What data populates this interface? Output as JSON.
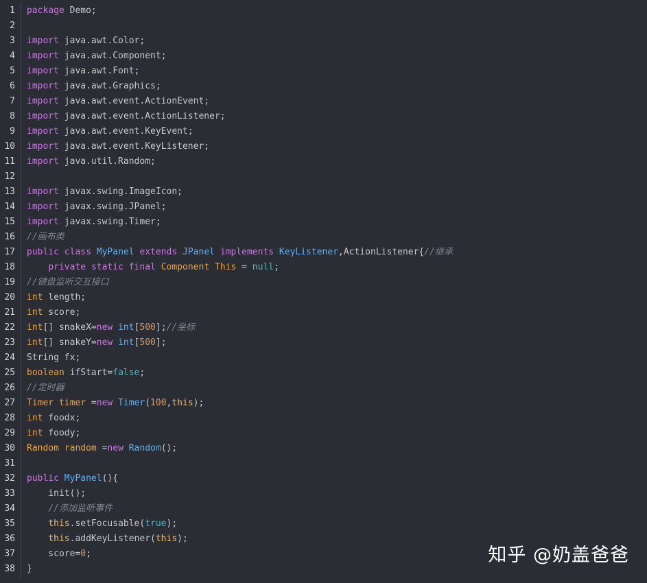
{
  "editor": {
    "lines": [
      {
        "n": "1",
        "t": [
          [
            "kw",
            "package"
          ],
          [
            "p",
            " Demo;"
          ]
        ]
      },
      {
        "n": "2",
        "t": []
      },
      {
        "n": "3",
        "t": [
          [
            "kw",
            "import"
          ],
          [
            "p",
            " java.awt.Color;"
          ]
        ]
      },
      {
        "n": "4",
        "t": [
          [
            "kw",
            "import"
          ],
          [
            "p",
            " java.awt.Component;"
          ]
        ]
      },
      {
        "n": "5",
        "t": [
          [
            "kw",
            "import"
          ],
          [
            "p",
            " java.awt.Font;"
          ]
        ]
      },
      {
        "n": "6",
        "t": [
          [
            "kw",
            "import"
          ],
          [
            "p",
            " java.awt.Graphics;"
          ]
        ]
      },
      {
        "n": "7",
        "t": [
          [
            "kw",
            "import"
          ],
          [
            "p",
            " java.awt.event.ActionEvent;"
          ]
        ]
      },
      {
        "n": "8",
        "t": [
          [
            "kw",
            "import"
          ],
          [
            "p",
            " java.awt.event.ActionListener;"
          ]
        ]
      },
      {
        "n": "9",
        "t": [
          [
            "kw",
            "import"
          ],
          [
            "p",
            " java.awt.event.KeyEvent;"
          ]
        ]
      },
      {
        "n": "10",
        "t": [
          [
            "kw",
            "import"
          ],
          [
            "p",
            " java.awt.event.KeyListener;"
          ]
        ]
      },
      {
        "n": "11",
        "t": [
          [
            "kw",
            "import"
          ],
          [
            "p",
            " java.util.Random;"
          ]
        ]
      },
      {
        "n": "12",
        "t": []
      },
      {
        "n": "13",
        "t": [
          [
            "kw",
            "import"
          ],
          [
            "p",
            " javax.swing.ImageIcon;"
          ]
        ]
      },
      {
        "n": "14",
        "t": [
          [
            "kw",
            "import"
          ],
          [
            "p",
            " javax.swing.JPanel;"
          ]
        ]
      },
      {
        "n": "15",
        "t": [
          [
            "kw",
            "import"
          ],
          [
            "p",
            " javax.swing.Timer;"
          ]
        ]
      },
      {
        "n": "16",
        "t": [
          [
            "cm",
            "//画布类"
          ]
        ]
      },
      {
        "n": "17",
        "t": [
          [
            "kw",
            "public"
          ],
          [
            "p",
            " "
          ],
          [
            "kw",
            "class"
          ],
          [
            "p",
            " "
          ],
          [
            "cl",
            "MyPanel"
          ],
          [
            "p",
            " "
          ],
          [
            "kw",
            "extends"
          ],
          [
            "p",
            " "
          ],
          [
            "cl",
            "JPanel"
          ],
          [
            "p",
            " "
          ],
          [
            "kw",
            "implements"
          ],
          [
            "p",
            " "
          ],
          [
            "cl",
            "KeyListener"
          ],
          [
            "p",
            ",ActionListener{"
          ],
          [
            "cm",
            "//继承"
          ]
        ]
      },
      {
        "n": "18",
        "t": [
          [
            "p",
            "    "
          ],
          [
            "kw",
            "private"
          ],
          [
            "p",
            " "
          ],
          [
            "kw",
            "static"
          ],
          [
            "p",
            " "
          ],
          [
            "kw",
            "final"
          ],
          [
            "p",
            " "
          ],
          [
            "ty",
            "Component"
          ],
          [
            "p",
            " "
          ],
          [
            "ty",
            "This"
          ],
          [
            "p",
            " = "
          ],
          [
            "ctrue",
            "null"
          ],
          [
            "p",
            ";"
          ]
        ]
      },
      {
        "n": "19",
        "t": [
          [
            "cm",
            "//键盘监听交互接口"
          ]
        ]
      },
      {
        "n": "20",
        "t": [
          [
            "ty",
            "int"
          ],
          [
            "p",
            " length;"
          ]
        ]
      },
      {
        "n": "21",
        "t": [
          [
            "ty",
            "int"
          ],
          [
            "p",
            " score;"
          ]
        ]
      },
      {
        "n": "22",
        "t": [
          [
            "ty",
            "int"
          ],
          [
            "p",
            "[] snakeX="
          ],
          [
            "kw",
            "new"
          ],
          [
            "p",
            " "
          ],
          [
            "cl",
            "int"
          ],
          [
            "p",
            "["
          ],
          [
            "num",
            "500"
          ],
          [
            "p",
            "];"
          ],
          [
            "cm",
            "//坐标"
          ]
        ]
      },
      {
        "n": "23",
        "t": [
          [
            "ty",
            "int"
          ],
          [
            "p",
            "[] snakeY="
          ],
          [
            "kw",
            "new"
          ],
          [
            "p",
            " "
          ],
          [
            "cl",
            "int"
          ],
          [
            "p",
            "["
          ],
          [
            "num",
            "500"
          ],
          [
            "p",
            "];"
          ]
        ]
      },
      {
        "n": "24",
        "t": [
          [
            "p",
            "String fx;"
          ]
        ]
      },
      {
        "n": "25",
        "t": [
          [
            "ty",
            "boolean"
          ],
          [
            "p",
            " ifStart="
          ],
          [
            "ctrue",
            "false"
          ],
          [
            "p",
            ";"
          ]
        ]
      },
      {
        "n": "26",
        "t": [
          [
            "cm",
            "//定时器"
          ]
        ]
      },
      {
        "n": "27",
        "t": [
          [
            "ty",
            "Timer"
          ],
          [
            "p",
            " "
          ],
          [
            "ty",
            "timer"
          ],
          [
            "p",
            " ="
          ],
          [
            "kw",
            "new"
          ],
          [
            "p",
            " "
          ],
          [
            "cl",
            "Timer"
          ],
          [
            "p",
            "("
          ],
          [
            "num",
            "100"
          ],
          [
            "p",
            ","
          ],
          [
            "cn",
            "this"
          ],
          [
            "p",
            ");"
          ]
        ]
      },
      {
        "n": "28",
        "t": [
          [
            "ty",
            "int"
          ],
          [
            "p",
            " foodx;"
          ]
        ]
      },
      {
        "n": "29",
        "t": [
          [
            "ty",
            "int"
          ],
          [
            "p",
            " foody;"
          ]
        ]
      },
      {
        "n": "30",
        "t": [
          [
            "ty",
            "Random"
          ],
          [
            "p",
            " "
          ],
          [
            "ty",
            "random"
          ],
          [
            "p",
            " ="
          ],
          [
            "kw",
            "new"
          ],
          [
            "p",
            " "
          ],
          [
            "cl",
            "Random"
          ],
          [
            "p",
            "();"
          ]
        ]
      },
      {
        "n": "31",
        "t": []
      },
      {
        "n": "32",
        "t": [
          [
            "kw",
            "public"
          ],
          [
            "p",
            " "
          ],
          [
            "cl",
            "MyPanel"
          ],
          [
            "p",
            "(){"
          ]
        ]
      },
      {
        "n": "33",
        "t": [
          [
            "p",
            "    init();"
          ]
        ]
      },
      {
        "n": "34",
        "t": [
          [
            "p",
            "    "
          ],
          [
            "cm",
            "//添加监听事件"
          ]
        ]
      },
      {
        "n": "35",
        "t": [
          [
            "p",
            "    "
          ],
          [
            "cn",
            "this"
          ],
          [
            "p",
            ".setFocusable("
          ],
          [
            "ctrue",
            "true"
          ],
          [
            "p",
            ");"
          ]
        ]
      },
      {
        "n": "36",
        "t": [
          [
            "p",
            "    "
          ],
          [
            "cn",
            "this"
          ],
          [
            "p",
            ".addKeyListener("
          ],
          [
            "cn",
            "this"
          ],
          [
            "p",
            ");"
          ]
        ]
      },
      {
        "n": "37",
        "t": [
          [
            "p",
            "    score="
          ],
          [
            "num",
            "0"
          ],
          [
            "p",
            ";"
          ]
        ]
      },
      {
        "n": "38",
        "t": [
          [
            "p",
            "}"
          ]
        ]
      }
    ]
  },
  "watermark": {
    "text": "知乎 @奶盖爸爸"
  }
}
